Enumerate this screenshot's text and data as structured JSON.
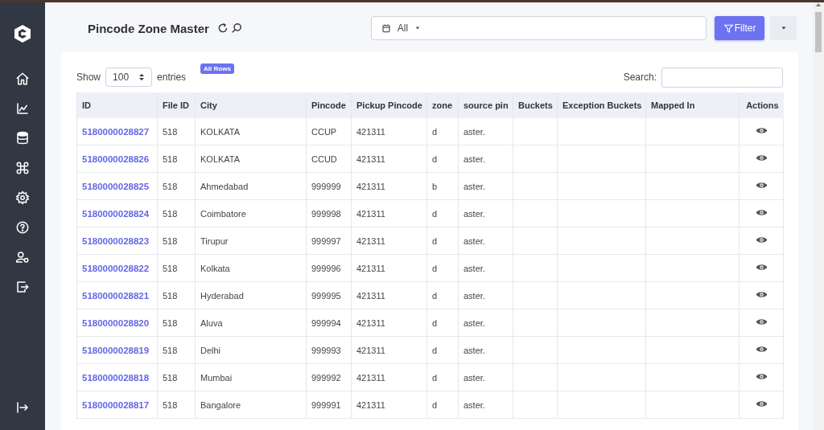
{
  "page": {
    "title": "Pincode Zone Master"
  },
  "date_filter": {
    "value": "All"
  },
  "filter_button": "Filter",
  "table_controls": {
    "show_label": "Show",
    "page_size": "100",
    "entries_label": "entries",
    "badge": "All Rows",
    "search_label": "Search:"
  },
  "table": {
    "columns": [
      "ID",
      "File ID",
      "City",
      "Pincode",
      "Pickup Pincode",
      "zone",
      "source pin",
      "Buckets",
      "Exception Buckets",
      "Mapped In",
      "Actions"
    ],
    "rows": [
      {
        "id": "5180000028827",
        "file_id": "518",
        "city": "KOLKATA",
        "pincode": "CCUP",
        "pickup_pincode": "421311",
        "zone": "d",
        "source_pin": "aster."
      },
      {
        "id": "5180000028826",
        "file_id": "518",
        "city": "KOLKATA",
        "pincode": "CCUD",
        "pickup_pincode": "421311",
        "zone": "d",
        "source_pin": "aster."
      },
      {
        "id": "5180000028825",
        "file_id": "518",
        "city": "Ahmedabad",
        "pincode": "999999",
        "pickup_pincode": "421311",
        "zone": "b",
        "source_pin": "aster."
      },
      {
        "id": "5180000028824",
        "file_id": "518",
        "city": "Coimbatore",
        "pincode": "999998",
        "pickup_pincode": "421311",
        "zone": "d",
        "source_pin": "aster."
      },
      {
        "id": "5180000028823",
        "file_id": "518",
        "city": "Tirupur",
        "pincode": "999997",
        "pickup_pincode": "421311",
        "zone": "d",
        "source_pin": "aster."
      },
      {
        "id": "5180000028822",
        "file_id": "518",
        "city": "Kolkata",
        "pincode": "999996",
        "pickup_pincode": "421311",
        "zone": "d",
        "source_pin": "aster."
      },
      {
        "id": "5180000028821",
        "file_id": "518",
        "city": "Hyderabad",
        "pincode": "999995",
        "pickup_pincode": "421311",
        "zone": "d",
        "source_pin": "aster."
      },
      {
        "id": "5180000028820",
        "file_id": "518",
        "city": "Aluva",
        "pincode": "999994",
        "pickup_pincode": "421311",
        "zone": "d",
        "source_pin": "aster."
      },
      {
        "id": "5180000028819",
        "file_id": "518",
        "city": "Delhi",
        "pincode": "999993",
        "pickup_pincode": "421311",
        "zone": "d",
        "source_pin": "aster."
      },
      {
        "id": "5180000028818",
        "file_id": "518",
        "city": "Mumbai",
        "pincode": "999992",
        "pickup_pincode": "421311",
        "zone": "d",
        "source_pin": "aster."
      },
      {
        "id": "5180000028817",
        "file_id": "518",
        "city": "Bangalore",
        "pincode": "999991",
        "pickup_pincode": "421311",
        "zone": "d",
        "source_pin": "aster."
      }
    ]
  }
}
